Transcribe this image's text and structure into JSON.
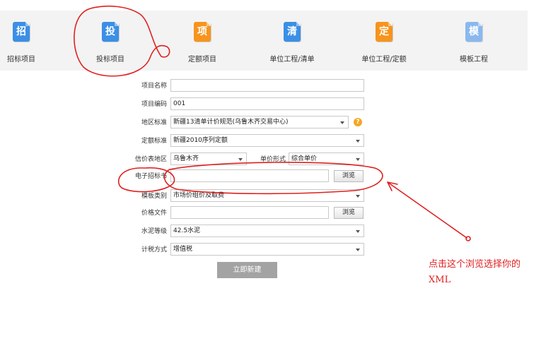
{
  "toolbar": {
    "items": [
      {
        "icon_char": "招",
        "label": "招标项目",
        "color": "#3b8fe6"
      },
      {
        "icon_char": "投",
        "label": "投标项目",
        "color": "#3b8fe6"
      },
      {
        "icon_char": "项",
        "label": "定额项目",
        "color": "#f7941d"
      },
      {
        "icon_char": "清",
        "label": "单位工程/清单",
        "color": "#3b8fe6"
      },
      {
        "icon_char": "定",
        "label": "单位工程/定额",
        "color": "#f7941d"
      },
      {
        "icon_char": "模",
        "label": "模板工程",
        "color": "#8ab8ee"
      }
    ]
  },
  "form": {
    "project_name": {
      "label": "项目名称",
      "value": ""
    },
    "project_code": {
      "label": "项目编码",
      "value": "001"
    },
    "region_standard": {
      "label": "地区标准",
      "value": "新疆13清单计价规范(乌鲁木齐交易中心)"
    },
    "quota_standard": {
      "label": "定额标准",
      "value": "新疆2010序列定额"
    },
    "price_region": {
      "label": "信价表地区",
      "value": "乌鲁木齐"
    },
    "price_form": {
      "label": "单价形式",
      "value": "综合单价"
    },
    "e_tender": {
      "label": "电子招标书",
      "value": "",
      "browse": "浏览"
    },
    "template_type": {
      "label": "模板类别",
      "value": "市场价组价及取费"
    },
    "price_file": {
      "label": "价格文件",
      "value": "",
      "browse": "浏览"
    },
    "cement_grade": {
      "label": "水泥等级",
      "value": "42.5水泥"
    },
    "tax_method": {
      "label": "计税方式",
      "value": "增值税"
    },
    "create_button": "立即新建"
  },
  "annotation": {
    "text": "点击这个浏览选择你的XML",
    "color": "#e02020"
  }
}
